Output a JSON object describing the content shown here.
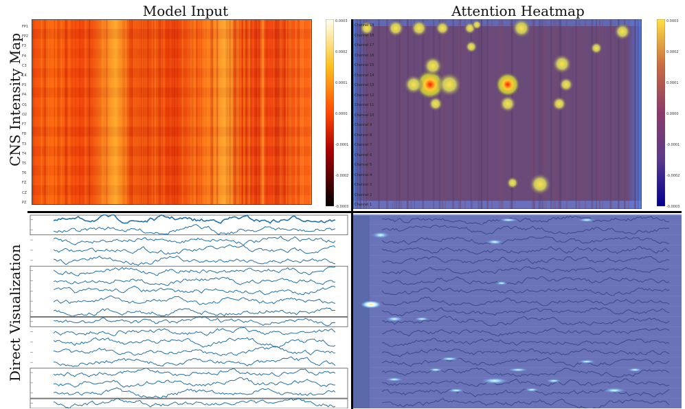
{
  "columns": {
    "left_title": "Model Input",
    "right_title": "Attention Heatmap"
  },
  "rows": {
    "top_title": "CNS Intensity Map",
    "bottom_title": "Direct Visualization"
  },
  "top_left": {
    "y_tick_labels": [
      "FP1",
      "FP2",
      "F3",
      "F4",
      "C3",
      "C4",
      "P3",
      "P4",
      "O1",
      "O2",
      "F7",
      "F8",
      "T3",
      "T4",
      "T5",
      "T6",
      "FZ",
      "CZ",
      "PZ"
    ],
    "colorbar_ticks": [
      "0.0003",
      "0.0002",
      "0.0001",
      "0.0000",
      "-0.0001",
      "-0.0002",
      "-0.0003"
    ],
    "colors": {
      "low": "#000000",
      "mid_low": "#cc1100",
      "mid": "#ff5a00",
      "mid_high": "#ffcc33",
      "high": "#ffffe8"
    }
  },
  "top_right": {
    "channel_labels": [
      "Channel 19",
      "Channel 18",
      "Channel 17",
      "Channel 16",
      "Channel 15",
      "Channel 14",
      "Channel 13",
      "Channel 12",
      "Channel 11",
      "Channel 10",
      "Channel 9",
      "Channel 8",
      "Channel 7",
      "Channel 6",
      "Channel 5",
      "Channel 4",
      "Channel 3",
      "Channel 2",
      "Channel 1"
    ],
    "colorbar_ticks": [
      "0.0003",
      "0.0002",
      "0.0001",
      "0.0000",
      "-0.0001",
      "-0.0002",
      "-0.0003"
    ],
    "colors": {
      "base": "#6b3a6e",
      "edge": "#5a6ed6",
      "hot": "#ff1a00",
      "warm": "#ffe14a"
    }
  },
  "bottom": {
    "trace_color": "#1f6fa8",
    "overlay_color": "#6a72b8",
    "highlight_color": "#7fc8ff"
  }
}
